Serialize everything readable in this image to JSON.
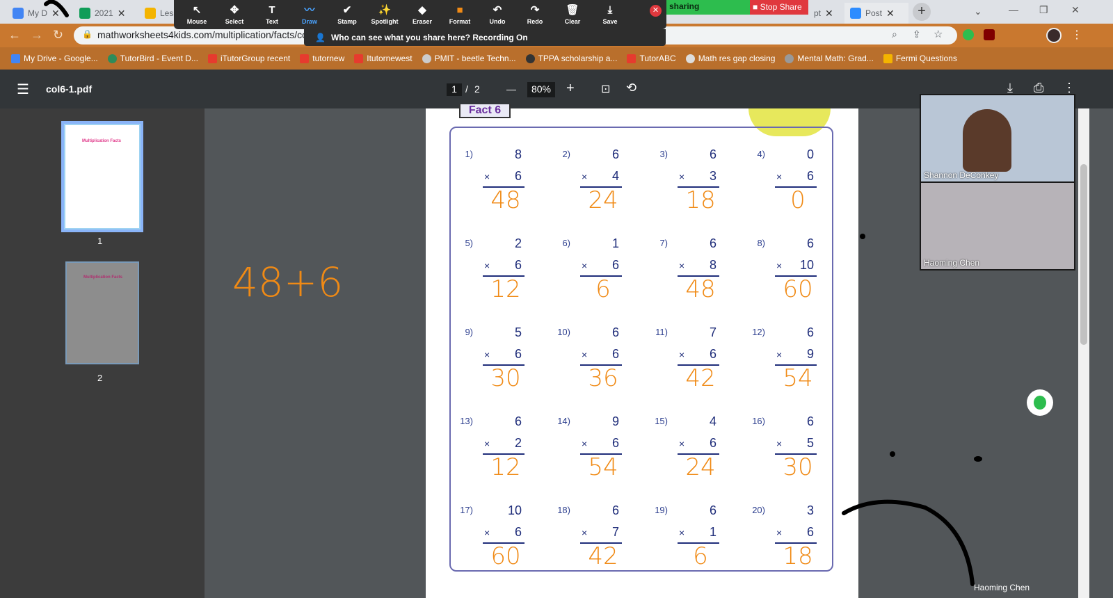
{
  "tabs": [
    {
      "label": "My D",
      "color": "#4285f4"
    },
    {
      "label": "2021",
      "color": "#0f9d58"
    },
    {
      "label": "Less",
      "color": "#f4b400"
    },
    {
      "label": "pt",
      "color": "#4a67d6"
    },
    {
      "label": "Post",
      "color": "#2d8cff"
    }
  ],
  "zoom_toolbar": {
    "items": [
      {
        "label": "Mouse",
        "icon": "↖"
      },
      {
        "label": "Select",
        "icon": "✥"
      },
      {
        "label": "Text",
        "icon": "T"
      },
      {
        "label": "Draw",
        "icon": "〰"
      },
      {
        "label": "Stamp",
        "icon": "✔"
      },
      {
        "label": "Spotlight",
        "icon": "✨"
      },
      {
        "label": "Eraser",
        "icon": "◆"
      },
      {
        "label": "Format",
        "icon": "■"
      },
      {
        "label": "Undo",
        "icon": "↶"
      },
      {
        "label": "Redo",
        "icon": "↷"
      },
      {
        "label": "Clear",
        "icon": "🗑"
      },
      {
        "label": "Save",
        "icon": "⤓"
      }
    ],
    "close_glyph": "✕",
    "sharing_label": "sharing",
    "stop_share_label": "Stop Share",
    "who_can_see": "Who can see what you share here? Recording On"
  },
  "address": {
    "url": "mathworksheets4kids.com/multiplication/facts/co"
  },
  "bookmarks": [
    "My Drive - Google...",
    "TutorBird - Event D...",
    "iTutorGroup recent",
    "tutornew",
    "Itutornewest",
    "PMIT - beetle Techn...",
    "TPPA scholarship a...",
    "TutorABC",
    "Math res gap closing",
    "Mental Math: Grad...",
    "Fermi Questions"
  ],
  "pdf": {
    "filename": "col6-1.pdf",
    "page_current": "1",
    "page_sep": "/",
    "page_total": "2",
    "zoom": "80%",
    "minus": "—",
    "plus": "+",
    "thumb_labels": [
      "1",
      "2"
    ],
    "thumb_title": "Multiplication Facts"
  },
  "worksheet": {
    "header_text": "Fact 6",
    "times_sign": "×",
    "problems": [
      {
        "n": "1)",
        "a": "8",
        "b": "6",
        "ans": "48"
      },
      {
        "n": "2)",
        "a": "6",
        "b": "4",
        "ans": "24"
      },
      {
        "n": "3)",
        "a": "6",
        "b": "3",
        "ans": "18"
      },
      {
        "n": "4)",
        "a": "0",
        "b": "6",
        "ans": "0"
      },
      {
        "n": "5)",
        "a": "2",
        "b": "6",
        "ans": "12"
      },
      {
        "n": "6)",
        "a": "1",
        "b": "6",
        "ans": "6"
      },
      {
        "n": "7)",
        "a": "6",
        "b": "8",
        "ans": "48"
      },
      {
        "n": "8)",
        "a": "6",
        "b": "10",
        "ans": "60"
      },
      {
        "n": "9)",
        "a": "5",
        "b": "6",
        "ans": "30"
      },
      {
        "n": "10)",
        "a": "6",
        "b": "6",
        "ans": "36"
      },
      {
        "n": "11)",
        "a": "7",
        "b": "6",
        "ans": "42"
      },
      {
        "n": "12)",
        "a": "6",
        "b": "9",
        "ans": "54"
      },
      {
        "n": "13)",
        "a": "6",
        "b": "2",
        "ans": "12"
      },
      {
        "n": "14)",
        "a": "9",
        "b": "6",
        "ans": "54"
      },
      {
        "n": "15)",
        "a": "4",
        "b": "6",
        "ans": "24"
      },
      {
        "n": "16)",
        "a": "6",
        "b": "5",
        "ans": "30"
      },
      {
        "n": "17)",
        "a": "10",
        "b": "6",
        "ans": "60"
      },
      {
        "n": "18)",
        "a": "6",
        "b": "7",
        "ans": "42"
      },
      {
        "n": "19)",
        "a": "6",
        "b": "1",
        "ans": "6"
      },
      {
        "n": "20)",
        "a": "3",
        "b": "6",
        "ans": "18"
      }
    ]
  },
  "annotation_text": "48+6",
  "participants": [
    {
      "name": "Shannon DeConkey"
    },
    {
      "name": "Haoming Chen"
    }
  ],
  "active_speaker_label": "Haoming Chen",
  "colors": {
    "ink": "#f08a15",
    "worksheet_text": "#1f2d7a",
    "accent_orange": "#c9782f"
  }
}
